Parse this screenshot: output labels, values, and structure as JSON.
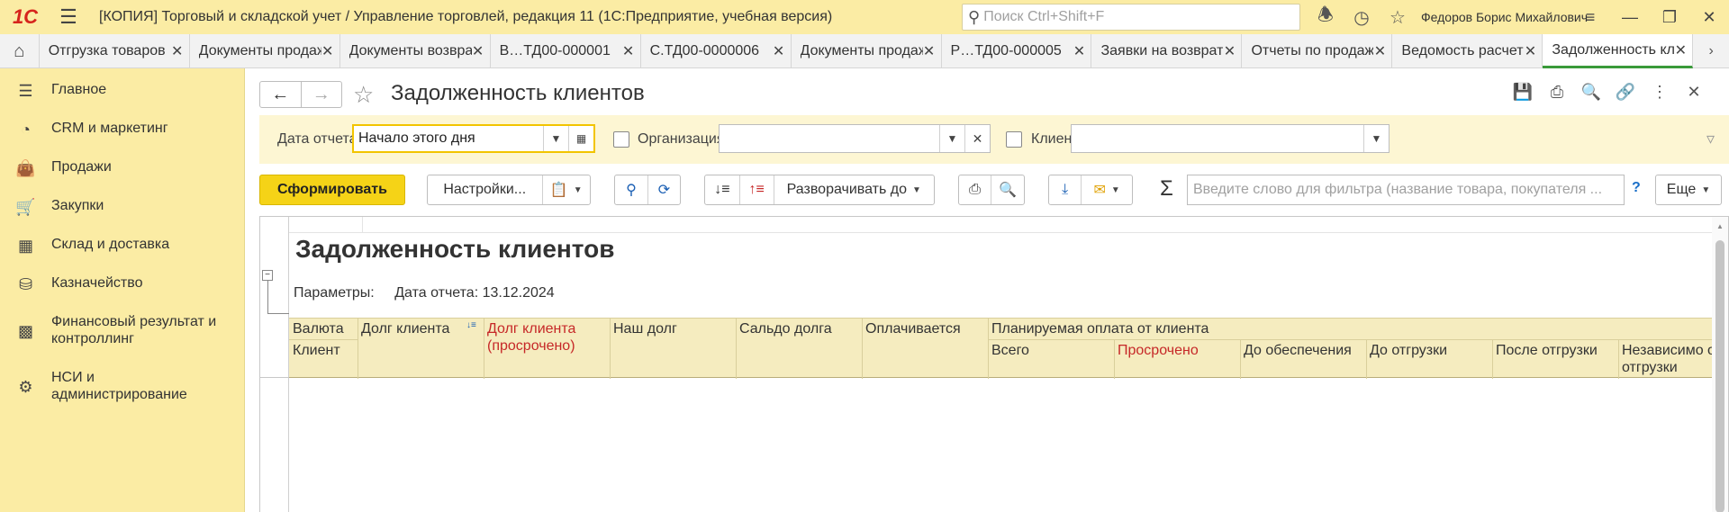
{
  "titlebar": {
    "logo": "1С",
    "title": "[КОПИЯ] Торговый и складской учет / Управление торговлей, редакция 11  (1С:Предприятие, учебная версия)",
    "search_placeholder": "Поиск Ctrl+Shift+F",
    "user": "Федоров Борис Михайлович"
  },
  "tabs": [
    {
      "label": "Отгрузка товаров"
    },
    {
      "label": "Документы продаж"
    },
    {
      "label": "Документы возврата"
    },
    {
      "label": "В…ТД00-000001"
    },
    {
      "label": "С.ТД00-0000006"
    },
    {
      "label": "Документы продаж"
    },
    {
      "label": "Р…ТД00-000005"
    },
    {
      "label": "Заявки на возврат"
    },
    {
      "label": "Отчеты по продажам"
    },
    {
      "label": "Ведомость расчетов"
    },
    {
      "label": "Задолженность клиентов"
    }
  ],
  "sidebar": {
    "items": [
      {
        "label": "Главное"
      },
      {
        "label": "CRM и маркетинг"
      },
      {
        "label": "Продажи"
      },
      {
        "label": "Закупки"
      },
      {
        "label": "Склад и доставка"
      },
      {
        "label": "Казначейство"
      },
      {
        "label": "Финансовый результат и"
      },
      {
        "label": "контроллинг"
      },
      {
        "label": "НСИ и"
      },
      {
        "label": "администрирование"
      }
    ]
  },
  "form": {
    "title": "Задолженность клиентов",
    "date_label": "Дата отчета:",
    "date_value": "Начало этого дня",
    "org_label": "Организация:",
    "org_value": "",
    "client_label": "Клиент:",
    "client_value": ""
  },
  "commands": {
    "generate": "Сформировать",
    "settings": "Настройки...",
    "expand_to": "Разворачивать до",
    "filter_placeholder": "Введите слово для фильтра (название товара, покупателя ...",
    "help": "?",
    "more": "Еще"
  },
  "report": {
    "title": "Задолженность клиентов",
    "params_label": "Параметры:",
    "params_value": "Дата отчета: 13.12.2024",
    "headers": {
      "currency": "Валюта",
      "client": "Клиент",
      "debt": "Долг клиента",
      "overdue_1": "Долг клиента",
      "overdue_2": "(просрочено)",
      "our_debt": "Наш долг",
      "balance": "Сальдо долга",
      "paying": "Оплачивается",
      "planned": "Планируемая оплата от клиента",
      "total": "Всего",
      "overdue": "Просрочено",
      "before_security": "До обеспечения",
      "before_shipment": "До отгрузки",
      "after_shipment": "После отгрузки",
      "independent_1": "Независимо от",
      "independent_2": "отгрузки"
    }
  }
}
